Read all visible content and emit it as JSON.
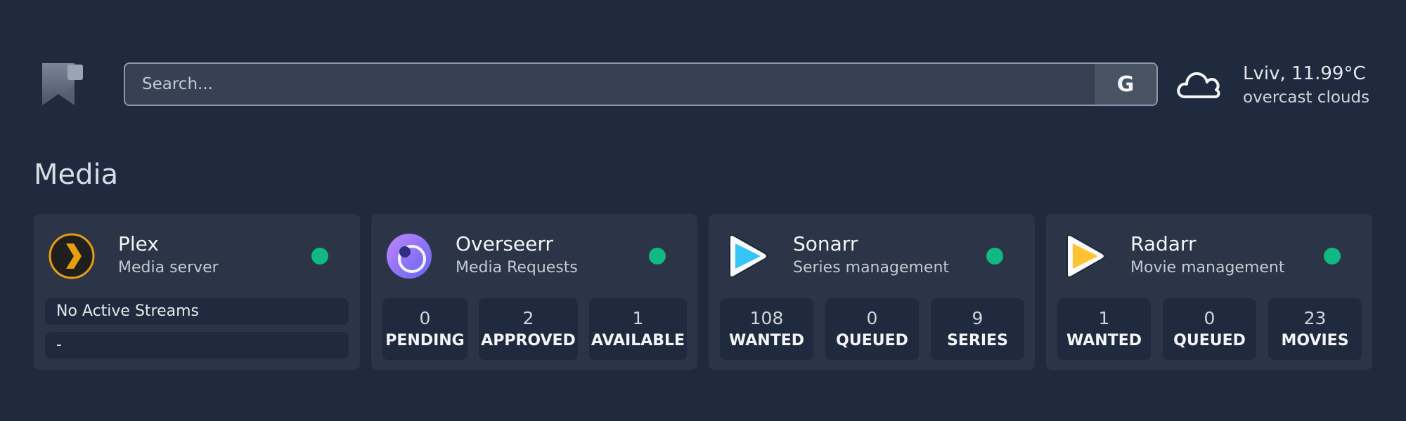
{
  "header": {
    "logo_icon": "bookmark-logo-icon",
    "search": {
      "placeholder": "Search...",
      "value": "",
      "engine_label": "G"
    },
    "weather": {
      "icon": "cloud-icon",
      "location_temp": "Lviv, 11.99°C",
      "description": "overcast clouds"
    }
  },
  "section": {
    "title": "Media"
  },
  "status_color": "#10b981",
  "cards": [
    {
      "name": "Plex",
      "description": "Media server",
      "icon": "plex-icon",
      "status": "online",
      "rows": [
        "No Active Streams",
        "-"
      ]
    },
    {
      "name": "Overseerr",
      "description": "Media Requests",
      "icon": "overseerr-icon",
      "status": "online",
      "stats": [
        {
          "value": "0",
          "label": "PENDING"
        },
        {
          "value": "2",
          "label": "APPROVED"
        },
        {
          "value": "1",
          "label": "AVAILABLE"
        }
      ]
    },
    {
      "name": "Sonarr",
      "description": "Series management",
      "icon": "sonarr-icon",
      "status": "online",
      "stats": [
        {
          "value": "108",
          "label": "WANTED"
        },
        {
          "value": "0",
          "label": "QUEUED"
        },
        {
          "value": "9",
          "label": "SERIES"
        }
      ]
    },
    {
      "name": "Radarr",
      "description": "Movie management",
      "icon": "radarr-icon",
      "status": "online",
      "stats": [
        {
          "value": "1",
          "label": "WANTED"
        },
        {
          "value": "0",
          "label": "QUEUED"
        },
        {
          "value": "23",
          "label": "MOVIES"
        }
      ]
    }
  ]
}
